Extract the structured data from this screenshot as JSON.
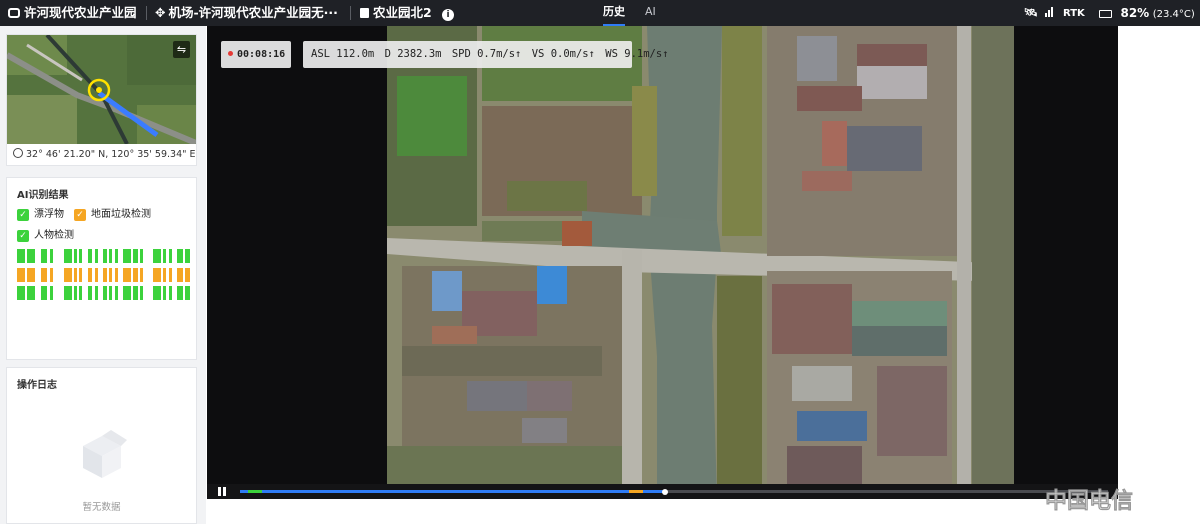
{
  "topbar": {
    "project": "许河现代农业产业园",
    "airport": "机场-许河现代农业产业园无···",
    "device": "农业园北2",
    "tabs": [
      "历史",
      "AI"
    ],
    "signal": "RTK",
    "battery_pct": "82%",
    "battery_temp": "(23.4°C)"
  },
  "minimap": {
    "coords": "32° 46' 21.20\" N, 120° 35' 59.34\" E"
  },
  "ai_results": {
    "title": "AI识别结果",
    "categories": [
      {
        "label": "漂浮物",
        "color": "#3cd23c"
      },
      {
        "label": "地面垃圾检测",
        "color": "#f5a623"
      },
      {
        "label": "人物检测",
        "color": "#3cd23c"
      }
    ]
  },
  "op_log": {
    "title": "操作日志",
    "empty": "暂无数据"
  },
  "hud": {
    "elapsed": "00:08:16",
    "asl_label": "ASL",
    "asl": "112.0m",
    "d_label": "D",
    "d": "2382.3m",
    "spd_label": "SPD",
    "spd": "0.7m/s",
    "vs_label": "VS",
    "vs": "0.0m/s",
    "ws_label": "WS",
    "ws": "9.1m/s"
  },
  "playback": {
    "progress": 0.49
  },
  "watermark": "中国电信",
  "colors": {
    "accent": "#2f7cf6",
    "topbar_bg": "#1f2126",
    "green": "#3cd23c",
    "orange": "#f5a623"
  }
}
